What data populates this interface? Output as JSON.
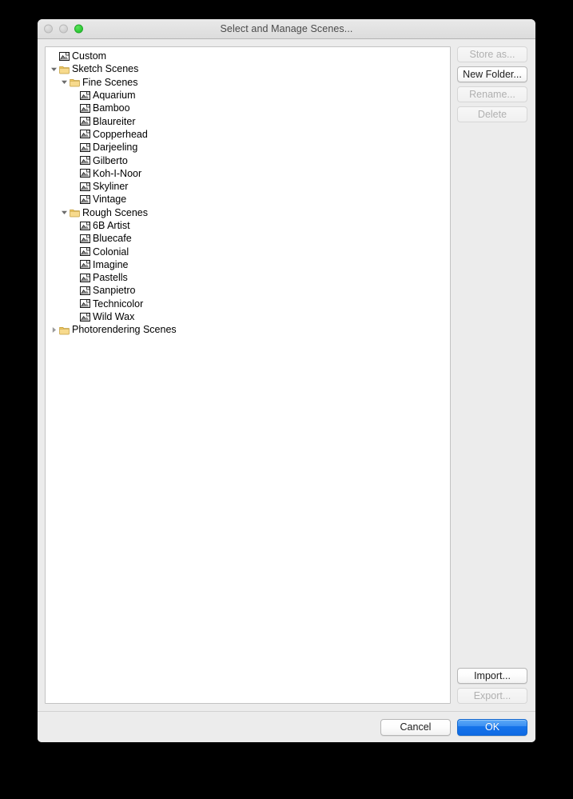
{
  "window": {
    "title": "Select and Manage Scenes...",
    "traffic_lights": [
      {
        "name": "close-button",
        "state": "inactive"
      },
      {
        "name": "minimize-button",
        "state": "inactive"
      },
      {
        "name": "maximize-button",
        "state": "green"
      }
    ]
  },
  "tree": {
    "items": [
      {
        "label": "Custom",
        "depth": 0,
        "type": "scene",
        "twisty": "none"
      },
      {
        "label": "Sketch Scenes",
        "depth": 0,
        "type": "folder",
        "twisty": "open"
      },
      {
        "label": "Fine Scenes",
        "depth": 1,
        "type": "folder",
        "twisty": "open"
      },
      {
        "label": "Aquarium",
        "depth": 2,
        "type": "scene",
        "twisty": "none"
      },
      {
        "label": "Bamboo",
        "depth": 2,
        "type": "scene",
        "twisty": "none"
      },
      {
        "label": "Blaureiter",
        "depth": 2,
        "type": "scene",
        "twisty": "none"
      },
      {
        "label": "Copperhead",
        "depth": 2,
        "type": "scene",
        "twisty": "none"
      },
      {
        "label": "Darjeeling",
        "depth": 2,
        "type": "scene",
        "twisty": "none"
      },
      {
        "label": "Gilberto",
        "depth": 2,
        "type": "scene",
        "twisty": "none"
      },
      {
        "label": "Koh-I-Noor",
        "depth": 2,
        "type": "scene",
        "twisty": "none"
      },
      {
        "label": "Skyliner",
        "depth": 2,
        "type": "scene",
        "twisty": "none"
      },
      {
        "label": "Vintage",
        "depth": 2,
        "type": "scene",
        "twisty": "none"
      },
      {
        "label": "Rough Scenes",
        "depth": 1,
        "type": "folder",
        "twisty": "open"
      },
      {
        "label": "6B Artist",
        "depth": 2,
        "type": "scene",
        "twisty": "none"
      },
      {
        "label": "Bluecafe",
        "depth": 2,
        "type": "scene",
        "twisty": "none"
      },
      {
        "label": "Colonial",
        "depth": 2,
        "type": "scene",
        "twisty": "none"
      },
      {
        "label": "Imagine",
        "depth": 2,
        "type": "scene",
        "twisty": "none"
      },
      {
        "label": "Pastells",
        "depth": 2,
        "type": "scene",
        "twisty": "none"
      },
      {
        "label": "Sanpietro",
        "depth": 2,
        "type": "scene",
        "twisty": "none"
      },
      {
        "label": "Technicolor",
        "depth": 2,
        "type": "scene",
        "twisty": "none"
      },
      {
        "label": "Wild Wax",
        "depth": 2,
        "type": "scene",
        "twisty": "none"
      },
      {
        "label": "Photorendering Scenes",
        "depth": 0,
        "type": "folder",
        "twisty": "closed"
      }
    ]
  },
  "side_buttons_top": [
    {
      "name": "store-as-button",
      "label": "Store as...",
      "enabled": false
    },
    {
      "name": "new-folder-button",
      "label": "New Folder...",
      "enabled": true
    },
    {
      "name": "rename-button",
      "label": "Rename...",
      "enabled": false
    },
    {
      "name": "delete-button",
      "label": "Delete",
      "enabled": false
    }
  ],
  "side_buttons_bottom": [
    {
      "name": "import-button",
      "label": "Import...",
      "enabled": true
    },
    {
      "name": "export-button",
      "label": "Export...",
      "enabled": false
    }
  ],
  "bottom_buttons": [
    {
      "name": "cancel-button",
      "label": "Cancel",
      "style": "secondary"
    },
    {
      "name": "ok-button",
      "label": "OK",
      "style": "primary"
    }
  ],
  "colors": {
    "window_background": "#ececec",
    "titlebar_top": "#e9e9e9",
    "titlebar_bottom": "#dcdcdc",
    "panel_background": "#ffffff",
    "panel_border": "#c3c3c3",
    "folder_icon": "#f2cd6a",
    "maximize_green": "#29c732",
    "primary_button_blue": "#1573ea",
    "text": "#000000",
    "disabled_text": "#b0b0b0",
    "title_text": "#4a4a4a"
  }
}
